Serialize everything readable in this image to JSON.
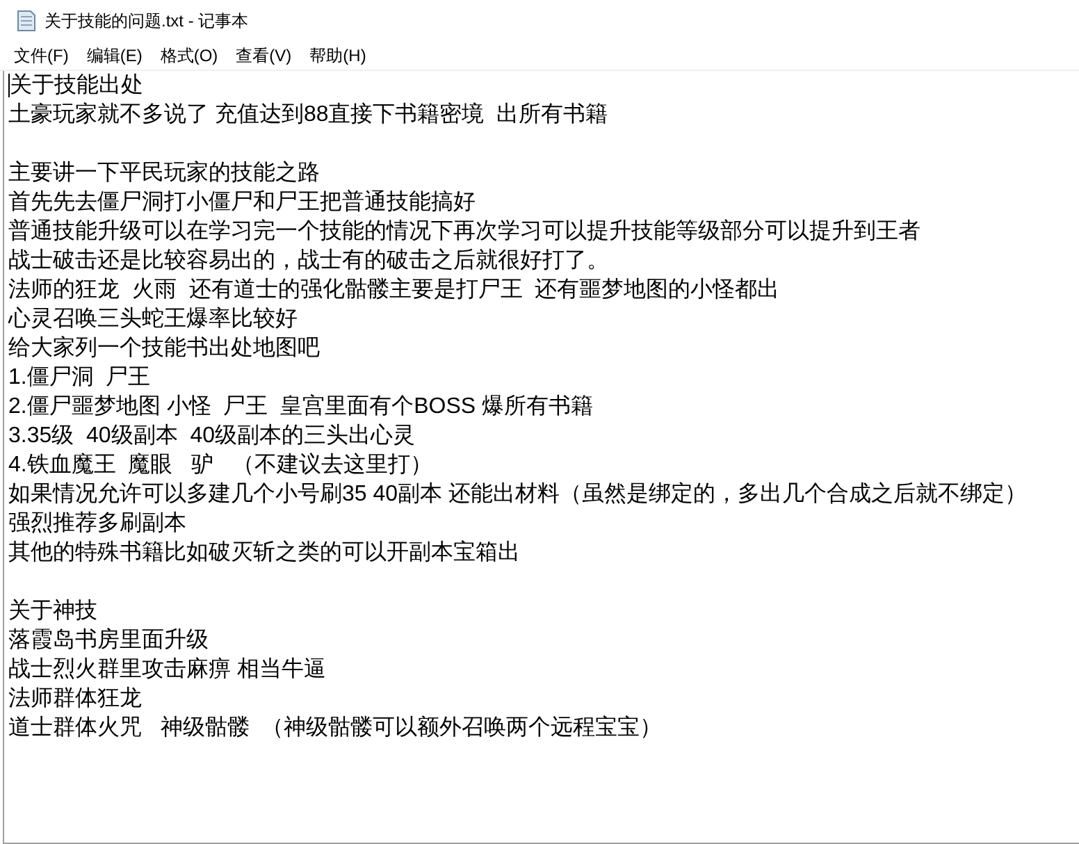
{
  "window": {
    "title": "关于技能的问题.txt - 记事本"
  },
  "menu": [
    "文件(F)",
    "编辑(E)",
    "格式(O)",
    "查看(V)",
    "帮助(H)"
  ],
  "document": {
    "paragraphs": [
      [
        "关于技能出处",
        "土豪玩家就不多说了 充值达到88直接下书籍密境  出所有书籍"
      ],
      [
        "主要讲一下平民玩家的技能之路",
        "首先先去僵尸洞打小僵尸和尸王把普通技能搞好",
        "普通技能升级可以在学习完一个技能的情况下再次学习可以提升技能等级部分可以提升到王者",
        "战士破击还是比较容易出的，战士有的破击之后就很好打了。",
        "法师的狂龙  火雨  还有道士的强化骷髅主要是打尸王  还有噩梦地图的小怪都出",
        "心灵召唤三头蛇王爆率比较好",
        "给大家列一个技能书出处地图吧",
        "1.僵尸洞  尸王",
        "2.僵尸噩梦地图 小怪  尸王  皇宫里面有个BOSS 爆所有书籍",
        "3.35级  40级副本  40级副本的三头出心灵",
        "4.铁血魔王  魔眼   驴   （不建议去这里打）",
        "如果情况允许可以多建几个小号刷35 40副本 还能出材料（虽然是绑定的，多出几个合成之后就不绑定）",
        "强烈推荐多刷副本",
        "其他的特殊书籍比如破灭斩之类的可以开副本宝箱出"
      ],
      [
        "关于神技",
        "落霞岛书房里面升级",
        "战士烈火群里攻击麻痹 相当牛逼",
        "法师群体狂龙",
        "道士群体火咒   神级骷髅  （神级骷髅可以额外召唤两个远程宝宝）"
      ]
    ]
  }
}
